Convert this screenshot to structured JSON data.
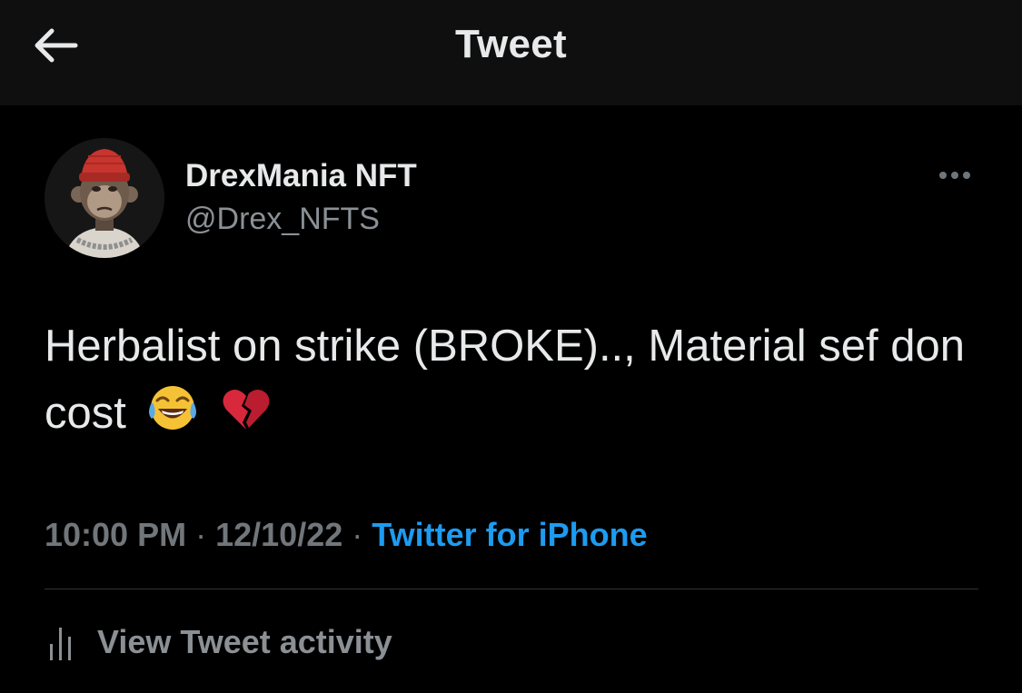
{
  "header": {
    "title": "Tweet",
    "back_icon": "arrow-left-icon"
  },
  "author": {
    "display_name": "DrexMania NFT",
    "handle": "@Drex_NFTS",
    "avatar": "ape-nft-avatar"
  },
  "tweet": {
    "text": "Herbalist on strike (BROKE).., Material sef don cost",
    "emojis": [
      "face-with-tears-of-joy-emoji",
      "broken-heart-emoji"
    ]
  },
  "meta": {
    "time": "10:00 PM",
    "separator": "·",
    "date": "12/10/22",
    "source": "Twitter for iPhone"
  },
  "activity": {
    "label": "View Tweet activity",
    "icon": "bar-chart-icon"
  },
  "colors": {
    "background": "#000000",
    "header_background": "#0f0f0f",
    "primary_text": "#e7e9ea",
    "secondary_text": "#71767b",
    "link": "#1d9bf0",
    "divider": "#2f3336"
  }
}
